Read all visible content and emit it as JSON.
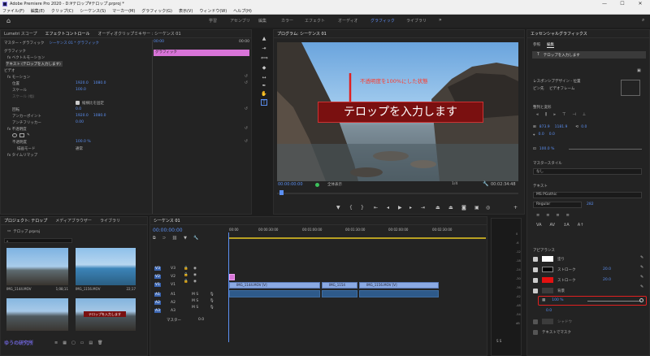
{
  "window": {
    "title": "Adobe Premiere Pro 2020 - D:¥テロップ¥テロップ.prproj *"
  },
  "menu": [
    "ファイル(F)",
    "編集(E)",
    "クリップ(C)",
    "シーケンス(S)",
    "マーカー(M)",
    "グラフィック(G)",
    "表示(V)",
    "ウィンドウ(W)",
    "ヘルプ(H)"
  ],
  "workspaces": [
    "学習",
    "アセンブリ",
    "編集",
    "カラー",
    "エフェクト",
    "オーディオ",
    "グラフィック",
    "ライブラリ"
  ],
  "workspace_active": "グラフィック",
  "effect_controls": {
    "tabs": [
      "Lumetri スコープ",
      "エフェクトコントロール",
      "オーディオクリップミキサー : シーケンス 01"
    ],
    "header_left": "マスター・グラフィック",
    "header_right": "シーケンス 01 * グラフィック",
    "timebar": [
      "00:00",
      "00:00"
    ],
    "graphic_clip": "グラフィック",
    "rows": [
      {
        "label": "グラフィック"
      },
      {
        "label": "fx  ベクトルモーション"
      },
      {
        "label": "テキスト (テロップを入力します)"
      },
      {
        "label": "ビデオ"
      },
      {
        "label": "fx  モーション"
      },
      {
        "label": "位置",
        "v1": "1920.0",
        "v2": "1080.0"
      },
      {
        "label": "スケール",
        "v1": "100.0"
      },
      {
        "label": "スケール (幅)"
      },
      {
        "label": "縦横比を固定",
        "check": true
      },
      {
        "label": "回転",
        "v1": "0.0"
      },
      {
        "label": "アンカーポイント",
        "v1": "1920.0",
        "v2": "1080.0"
      },
      {
        "label": "アンチフリッカー",
        "v1": "0.00"
      },
      {
        "label": "fx  不透明度"
      },
      {
        "label": "マスク"
      },
      {
        "label": "不透明度",
        "v1": "100.0 %"
      },
      {
        "label": "描画モード",
        "v1": "通常"
      },
      {
        "label": "fx  タイムリマップ"
      }
    ]
  },
  "program": {
    "title": "プログラム: シーケンス 01",
    "annotation": "不透明度を100%にした状態",
    "telop": "テロップを入力します",
    "timecode": "00:00:00:00",
    "fit": "全体表示",
    "quality": "1/4",
    "duration": "00:02:34:48"
  },
  "project": {
    "tabs": [
      "プロジェクト: テロップ",
      "メディアブラウザー",
      "ライブラリ"
    ],
    "path": "テロップ.prproj",
    "items": [
      {
        "name": "IMG_1144.MOV",
        "dur": "1;08;11"
      },
      {
        "name": "IMG_1156.MOV",
        "dur": "22;17"
      },
      {
        "name": "",
        "dur": ""
      },
      {
        "name": "テロップを入力します",
        "dur": ""
      }
    ]
  },
  "timeline": {
    "tab": "シーケンス 01",
    "timecode": "00:00:00:00",
    "ruler": [
      "00:00",
      "00:00:30:00",
      "00:01:00:00",
      "00:01:30:00",
      "00:02:00:00",
      "00:02:30:00"
    ],
    "tracks": [
      "V3",
      "V2",
      "V1",
      "A1",
      "A2",
      "A3"
    ],
    "master": "マスター",
    "master_val": "0.0",
    "clips": [
      "IMG_1144.MOV [V]",
      "IMG_1154",
      "IMG_1156.MOV [V]"
    ]
  },
  "essential": {
    "title": "エッセンシャルグラフィックス",
    "tabs": [
      "参照",
      "編集"
    ],
    "layer": "テロップを入力します",
    "responsive": "レスポンシブデザイン - 位置",
    "pin": "ピン先",
    "pin_val": "ビデオフレーム",
    "align": "整列と変形",
    "pos_x": "873.9",
    "pos_y": "1181.9",
    "rot": "0.0",
    "scale": "100.0 %",
    "master_style": "マスタースタイル",
    "master_style_val": "なし",
    "text_section": "テキスト",
    "font": "MS PGothic",
    "weight": "Regular",
    "font_size": "282",
    "appearance": "アピアランス",
    "fill": "塗り",
    "stroke1": "ストローク",
    "stroke1_val": "20.0",
    "stroke2": "ストローク",
    "stroke2_val": "20.0",
    "bg": "背景",
    "opacity": "100 %",
    "bg_val": "0.0",
    "shadow": "シャドウ",
    "mask": "テキストでマスク",
    "colors": {
      "fill": "#ffffff",
      "stroke1": "#000000",
      "stroke2": "#e41111",
      "bg": "#3c3c3c"
    }
  },
  "watermark": "ゆうの研究所"
}
